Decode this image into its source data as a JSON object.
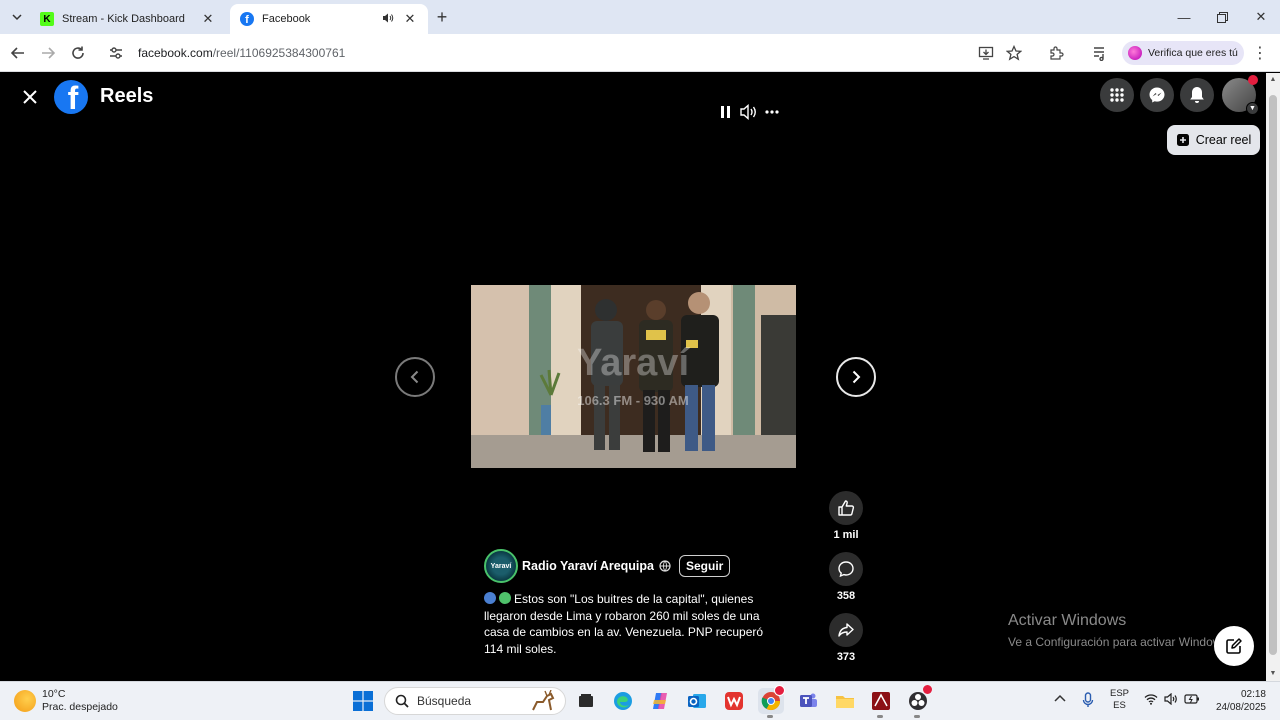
{
  "browser": {
    "tabs": [
      {
        "title": "Stream - Kick Dashboard",
        "active": false
      },
      {
        "title": "Facebook",
        "active": true
      }
    ],
    "url_host": "facebook.com",
    "url_path": "/reel/1106925384300761",
    "verify_label": "Verifica que eres tú"
  },
  "page": {
    "brand": "Reels",
    "create_reel_label": "Crear reel",
    "author": {
      "name": "Radio Yaraví Arequipa",
      "avatar_text": "Yaraví",
      "follow_label": "Seguir"
    },
    "caption": "Estos son \"Los buitres de la capital\", quienes llegaron desde Lima y robaron 260 mil soles de una casa de cambios en la av. Venezuela. PNP recuperó 114 mil soles.",
    "watermark": {
      "line1": "Yaraví",
      "line2": "106.3 FM - 930 AM"
    },
    "actions": {
      "likes": "1 mil",
      "comments": "358",
      "shares": "373"
    },
    "activate_windows": {
      "title": "Activar Windows",
      "subtitle": "Ve a Configuración para activar Windows."
    }
  },
  "taskbar": {
    "weather_temp": "10°C",
    "weather_desc": "Prac. despejado",
    "search_placeholder": "Búsqueda",
    "lang_top": "ESP",
    "lang_bottom": "ES",
    "time": "02:18",
    "date": "24/08/2025"
  },
  "colors": {
    "facebook_blue": "#1877f2",
    "page_bg": "#000000",
    "tab_strip": "#dfe6f3"
  }
}
